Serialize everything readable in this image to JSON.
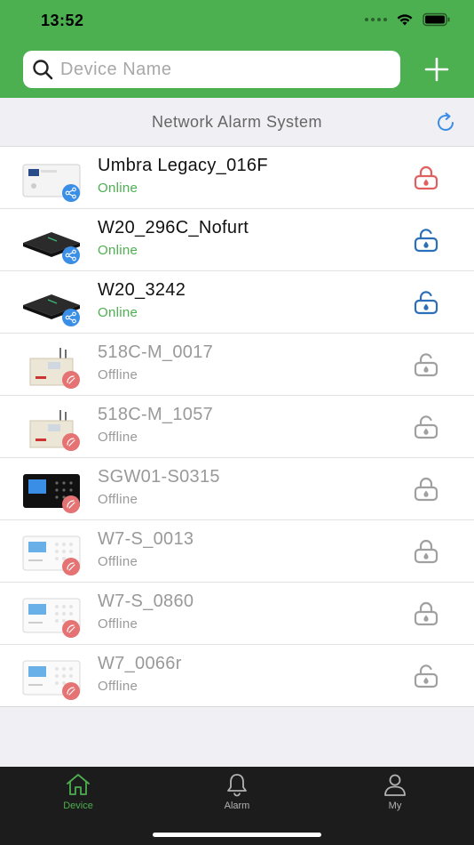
{
  "status_bar": {
    "time": "13:52"
  },
  "search": {
    "placeholder": "Device Name"
  },
  "subheader": {
    "title": "Network Alarm System"
  },
  "colors": {
    "brand": "#4caf50",
    "online": "#4caf50",
    "locked_red": "#e06060",
    "unlocked_blue": "#2a6fb8",
    "offline_gray": "#a0a0a0"
  },
  "devices": [
    {
      "name": "Umbra Legacy_016F",
      "status": "Online",
      "lock_icon": "lock-closed-red-icon",
      "thumb": "white-panel",
      "badge": "share"
    },
    {
      "name": "W20_296C_Nofurt",
      "status": "Online",
      "lock_icon": "lock-open-blue-icon",
      "thumb": "black-hub",
      "badge": "share"
    },
    {
      "name": "W20_3242",
      "status": "Online",
      "lock_icon": "lock-open-blue-icon",
      "thumb": "black-hub",
      "badge": "share"
    },
    {
      "name": "518C-M_0017",
      "status": "Offline",
      "lock_icon": "lock-open-gray-icon",
      "thumb": "antenna-panel",
      "badge": "pink"
    },
    {
      "name": "518C-M_1057",
      "status": "Offline",
      "lock_icon": "lock-open-gray-icon",
      "thumb": "antenna-panel",
      "badge": "pink"
    },
    {
      "name": "SGW01-S0315",
      "status": "Offline",
      "lock_icon": "lock-closed-gray-icon",
      "thumb": "black-keypad",
      "badge": "pink"
    },
    {
      "name": "W7-S_0013",
      "status": "Offline",
      "lock_icon": "lock-closed-gray-icon",
      "thumb": "white-keypad",
      "badge": "pink"
    },
    {
      "name": "W7-S_0860",
      "status": "Offline",
      "lock_icon": "lock-closed-gray-icon",
      "thumb": "white-keypad",
      "badge": "pink"
    },
    {
      "name": "W7_0066r",
      "status": "Offline",
      "lock_icon": "lock-open-gray-icon",
      "thumb": "white-keypad",
      "badge": "pink"
    }
  ],
  "tabbar": {
    "tabs": [
      {
        "label": "Device",
        "icon": "home-icon",
        "active": true
      },
      {
        "label": "Alarm",
        "icon": "bell-icon",
        "active": false
      },
      {
        "label": "My",
        "icon": "person-icon",
        "active": false
      }
    ]
  }
}
